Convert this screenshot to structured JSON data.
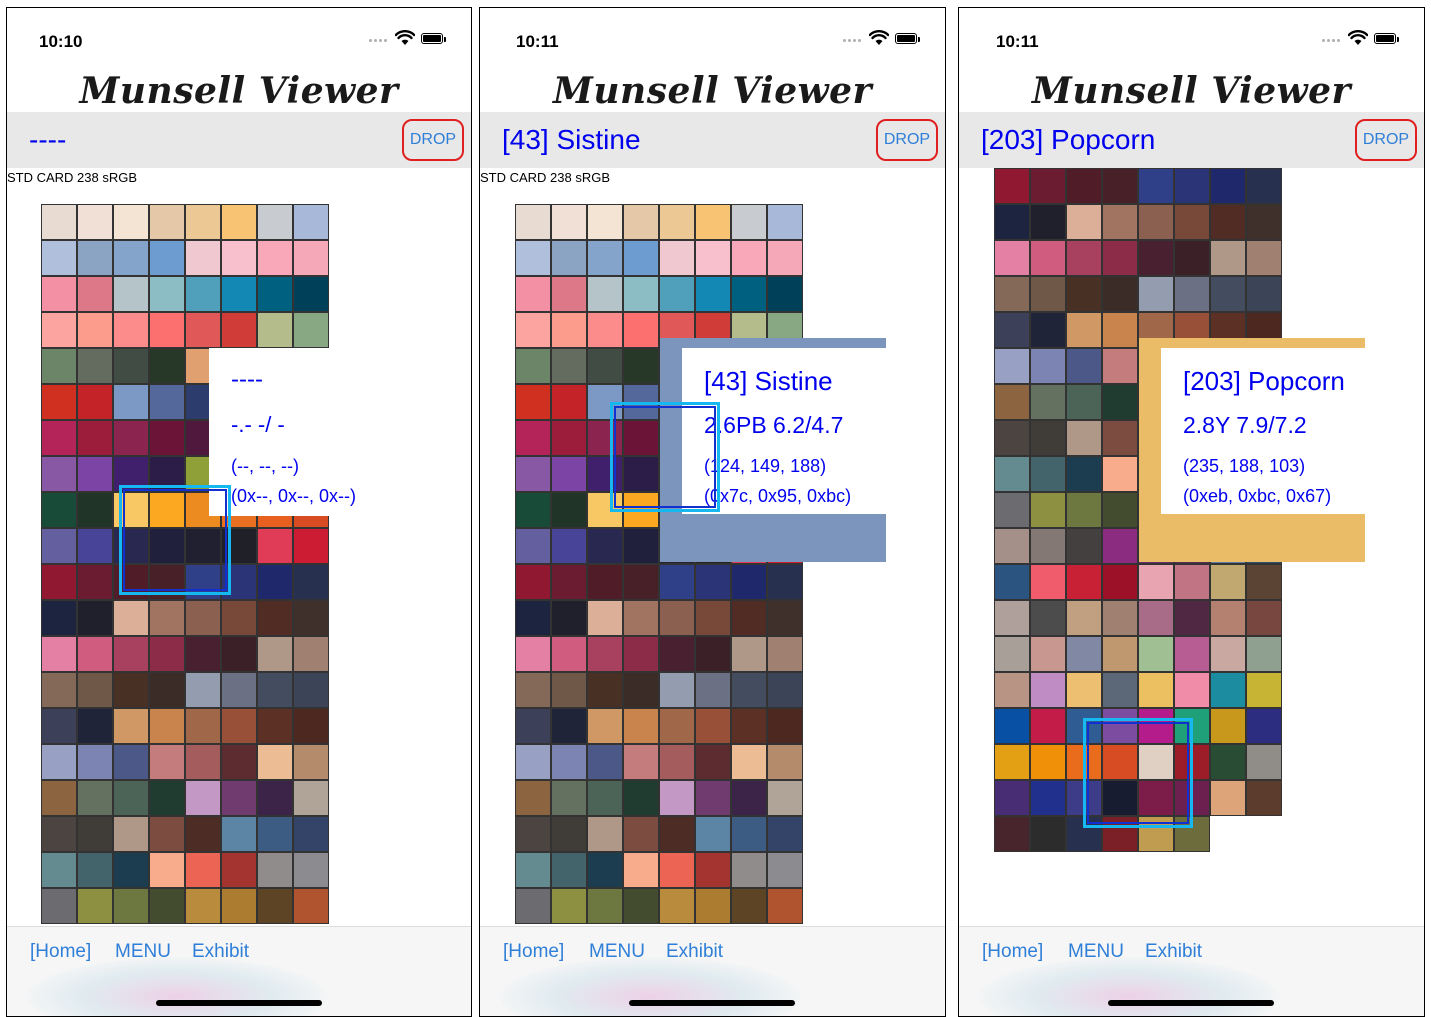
{
  "app_title": "Munsell Viewer",
  "drop_label": "DROP",
  "card_label": "STD CARD 238 sRGB",
  "nav": {
    "home": "[Home]",
    "menu": "MENU",
    "exhibit": "Exhibit"
  },
  "screens": [
    {
      "time": "10:10",
      "selection": "----",
      "show_card_label": true,
      "info": {
        "name": "----",
        "munsell": "-.- -/ -",
        "rgb": "(--, --, --)",
        "hex": "(0x--, 0x--, 0x--)"
      }
    },
    {
      "time": "10:11",
      "selection": "[43]  Sistine",
      "show_card_label": true,
      "info": {
        "name": "[43]  Sistine",
        "munsell": "2.6PB 6.2/4.7",
        "rgb": "(124, 149, 188)",
        "hex": "(0x7c, 0x95, 0xbc)",
        "color": "#7c95bc"
      }
    },
    {
      "time": "10:11",
      "selection": "[203]  Popcorn",
      "show_card_label": false,
      "info": {
        "name": "[203]  Popcorn",
        "munsell": "2.8Y 7.9/7.2",
        "rgb": "(235, 188, 103)",
        "hex": "(0xeb, 0xbc, 0x67)",
        "color": "#ebbc67"
      }
    }
  ],
  "swatch_rows_top": [
    [
      "#e8dcd2",
      "#f0e0d6",
      "#f4e4d4",
      "#e4c8a8",
      "#ecc894",
      "#f8c474",
      "#c8ccd0",
      "#a8b8d8"
    ],
    [
      "#b0c0dc",
      "#8ca4c4",
      "#84a4cc",
      "#6c9cd0",
      "#f0c8d0",
      "#f8c0cc",
      "#f8a8b8",
      "#f4a8b8"
    ],
    [
      "#f490a4",
      "#dc7888",
      "#b4c4c8",
      "#8cbcc4",
      "#50a0bc",
      "#1488b4",
      "#006080",
      "#004058"
    ],
    [
      "#fca4a0",
      "#fc9c8c",
      "#fc8c8c",
      "#fc7070",
      "#e05858",
      "#d03c38",
      "#b4bc8c",
      "#88a884"
    ],
    [
      "#6c8468",
      "#646c60",
      "#404c44",
      "#283828",
      "#e0a070",
      "#d08060",
      "#a87870",
      "#887068"
    ],
    [
      "#d03020",
      "#c42428",
      "#7c98c4",
      "#54689c",
      "#2c3c6c",
      "#2c3850",
      "#7c8490",
      "#6c7888"
    ],
    [
      "#b42458",
      "#9c1c3c",
      "#8c2450",
      "#6c1438",
      "#50183c",
      "#402030",
      "#604860",
      "#504050"
    ],
    [
      "#8858a4",
      "#7c44a4",
      "#40206c",
      "#2c1c48",
      "#90a038",
      "#b0a840",
      "#90c040",
      "#6c9028"
    ],
    [
      "#184c38",
      "#203428",
      "#f8c864",
      "#fca820",
      "#ec8c20",
      "#e87020",
      "#e86020",
      "#d84c24"
    ],
    [
      "#6460a0",
      "#484498",
      "#282850",
      "#20203c",
      "#202030",
      "#202028",
      "#e03c58",
      "#cc1c34"
    ]
  ],
  "swatch_rows_mid": [
    [
      "#901830",
      "#6c1c30",
      "#501c28",
      "#482028",
      "#304088",
      "#2c3478",
      "#20286c",
      "#283050"
    ],
    [
      "#1c2440",
      "#20202c",
      "#dcb098",
      "#a07460",
      "#8c6050",
      "#784838",
      "#502c24",
      "#40302c"
    ],
    [
      "#e480a4",
      "#d05c80",
      "#a84060",
      "#8c2c48",
      "#482030",
      "#3c2028",
      "#b09888",
      "#a08070"
    ],
    [
      "#846858",
      "#705848",
      "#483024",
      "#3c2c28",
      "#949cb0",
      "#6c7084",
      "#444c60",
      "#3c4458"
    ],
    [
      "#3c4058",
      "#202438",
      "#d09864",
      "#c8844c",
      "#a06848",
      "#985038",
      "#5c3024",
      "#4c2820"
    ],
    [
      "#98a0c4",
      "#7c84b4",
      "#4c5888",
      "#c47c7c",
      "#a45c5c",
      "#5c2c30",
      "#ecbc94",
      "#b48c6c"
    ],
    [
      "#8c6440",
      "#647060",
      "#4c6458",
      "#203c30",
      "#c498c4",
      "#703c70",
      "#3c2448",
      "#b0a498"
    ],
    [
      "#4c4440",
      "#403c38",
      "#b09888",
      "#7c4c40",
      "#4c2c24",
      "#5c84a4",
      "#3c5c84",
      "#344468"
    ],
    [
      "#648c90",
      "#44646c",
      "#1c3c50",
      "#f8ac8c",
      "#ec6454",
      "#a43430",
      "#908c8c",
      "#8c8c90"
    ],
    [
      "#6c6c70",
      "#8c9040",
      "#6c7840",
      "#444c30",
      "#b88c3c",
      "#ac7c30",
      "#5c4424",
      "#b05430"
    ]
  ],
  "swatch_rows_third": [
    [
      "#a49088",
      "#847874",
      "#444040",
      "#8c2c80",
      "#6c2c70",
      "#5c2c58",
      "#5c7ca0",
      "#285470"
    ],
    [
      "#2c5480",
      "#f05c6c",
      "#c82034",
      "#9c1028",
      "#e8a4b0",
      "#c07484",
      "#c0a870",
      "#5c4434"
    ],
    [
      "#b0a09c",
      "#4c4c4c",
      "#c0a080",
      "#a08070",
      "#a86c88",
      "#502844",
      "#b48070",
      "#784840"
    ],
    [
      "#a8a098",
      "#c89890",
      "#8088a4",
      "#c09870",
      "#a0c094",
      "#b85c94",
      "#c8a8a0",
      "#90a090"
    ],
    [
      "#b89484",
      "#c08cc4",
      "#ecc070",
      "#5c6878",
      "#ecc060",
      "#f08ca8",
      "#1c8ca0",
      "#c8b434"
    ],
    [
      "#0850a4",
      "#c41c48",
      "#305c94",
      "#7c4ca0",
      "#b41c8c",
      "#20a078",
      "#c8981c",
      "#2c2c80"
    ],
    [
      "#e4a014",
      "#f09008",
      "#e86c1c",
      "#d84c24",
      "#e0d0c4",
      "#9c1c28",
      "#284c34",
      "#908c88"
    ],
    [
      "#482c74",
      "#20308c",
      "#3c3c88",
      "#181c30",
      "#7c1c48",
      "#6c2050",
      "#dca478",
      "#5c3c2c"
    ],
    [
      "#48242c",
      "#2c2c2c",
      "#283050",
      "#7c2028",
      "#c09c50",
      "#6c6c3c"
    ]
  ]
}
